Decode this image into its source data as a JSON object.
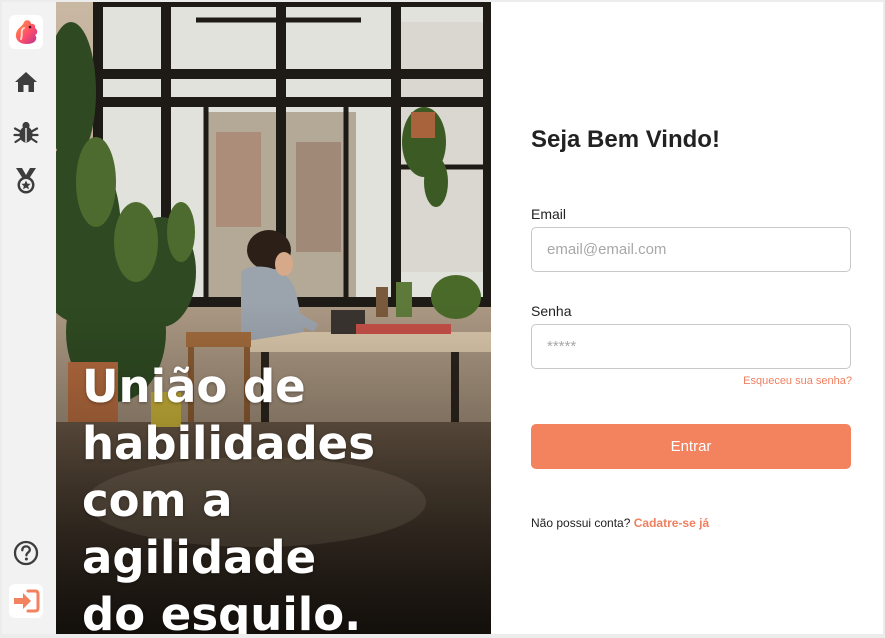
{
  "sidebar": {
    "items": [
      {
        "icon": "squirrel-logo-icon"
      },
      {
        "icon": "home-icon"
      },
      {
        "icon": "bug-icon"
      },
      {
        "icon": "medal-icon"
      }
    ],
    "bottom": [
      {
        "icon": "help-icon"
      },
      {
        "icon": "login-icon"
      }
    ]
  },
  "hero": {
    "line1": "União de",
    "line2": "habilidades",
    "line3": "com a agilidade",
    "line4": "do esquilo."
  },
  "form": {
    "title": "Seja Bem Vindo!",
    "email_label": "Email",
    "email_placeholder": "email@email.com",
    "password_label": "Senha",
    "password_placeholder": "*****",
    "forgot_label": "Esqueceu sua senha?",
    "submit_label": "Entrar",
    "signup_prompt": "Não possui conta?",
    "signup_link": "Cadatre-se já"
  },
  "colors": {
    "accent": "#f3825f",
    "link": "#ef7f5f",
    "sidebar_bg": "#f2f2f2"
  }
}
